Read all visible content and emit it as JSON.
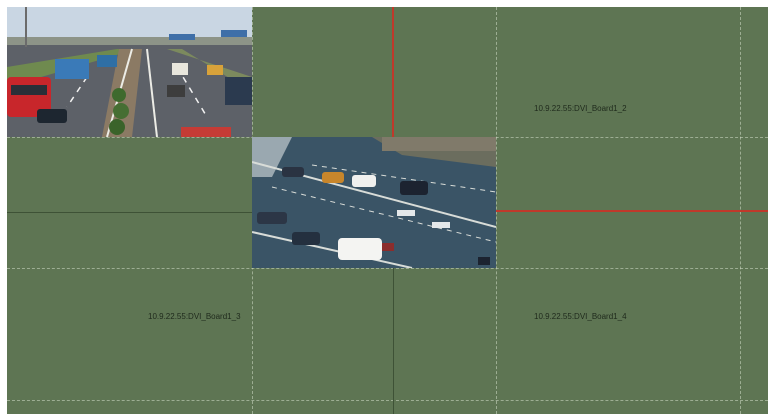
{
  "video_wall": {
    "screens": [
      {
        "label": "10.9.22.55:DVI_Board1_2"
      },
      {
        "label": "10.9.22.55:DVI_Board1_3"
      },
      {
        "label": "10.9.22.55:DVI_Board1_4"
      }
    ],
    "windows": [
      {
        "content": "highway-traffic-video"
      },
      {
        "content": "intersection-traffic-video"
      }
    ],
    "colors": {
      "background": "#5e7553",
      "selection_border": "#c0392b",
      "grid_line": "#3e5236"
    }
  }
}
